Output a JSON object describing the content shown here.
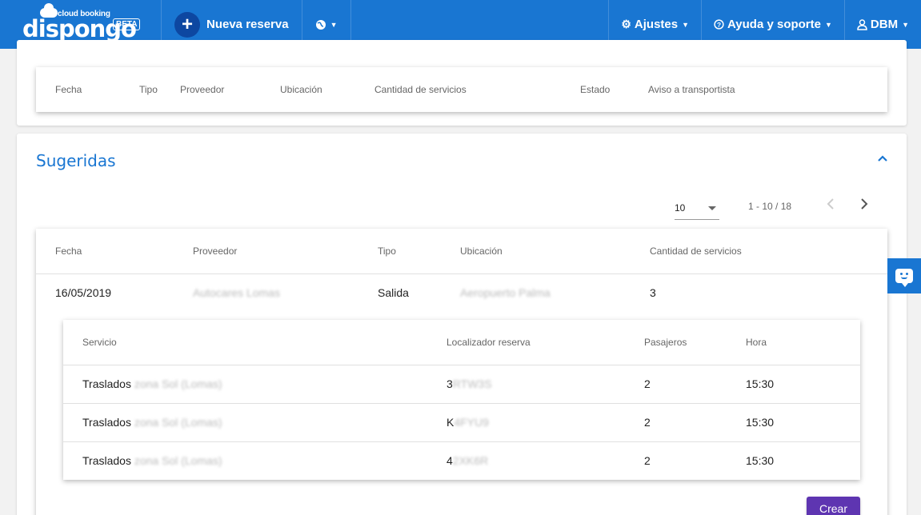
{
  "brand": {
    "tag": "cloud booking",
    "name": "dispongo",
    "badge": "BETA"
  },
  "nav": {
    "new_booking": "Nueva reserva",
    "settings": "Ajustes",
    "help": "Ayuda y soporte",
    "user": "DBM"
  },
  "top_table": {
    "headers": [
      "Fecha",
      "Tipo",
      "Proveedor",
      "Ubicación",
      "Cantidad de servicios",
      "Estado",
      "Aviso a transportista"
    ]
  },
  "suggested": {
    "title": "Sugeridas",
    "page_size": "10",
    "range": "1 - 10 / 18",
    "headers": [
      "Fecha",
      "Proveedor",
      "Tipo",
      "Ubicación",
      "Cantidad de servicios"
    ],
    "row": {
      "fecha": "16/05/2019",
      "proveedor": "Autocares Lomas",
      "tipo": "Salida",
      "ubicacion": "Aeropuerto Palma",
      "cantidad": "3"
    },
    "detail_headers": [
      "Servicio",
      "Localizador reserva",
      "Pasajeros",
      "Hora"
    ],
    "detail_rows": [
      {
        "servicio": "Traslados",
        "servicio_hidden": " zona Sol (Lomas)",
        "localizador": "3",
        "localizador_hidden": "RTW3S",
        "pasajeros": "2",
        "hora": "15:30"
      },
      {
        "servicio": "Traslados",
        "servicio_hidden": " zona Sol (Lomas)",
        "localizador": "K",
        "localizador_hidden": "4FYU9",
        "pasajeros": "2",
        "hora": "15:30"
      },
      {
        "servicio": "Traslados",
        "servicio_hidden": " zona Sol (Lomas)",
        "localizador": "4",
        "localizador_hidden": "2XK6R",
        "pasajeros": "2",
        "hora": "15:30"
      }
    ],
    "create_button": "Crear"
  },
  "icons": {
    "plus": "plus-icon",
    "globe": "globe-icon",
    "gear": "gear-icon",
    "help": "question-circle-icon",
    "user": "user-icon",
    "chevron_up": "chevron-up-icon",
    "chat": "chat-icon"
  },
  "colors": {
    "primary": "#1976d2",
    "accent": "#5e35b1"
  }
}
